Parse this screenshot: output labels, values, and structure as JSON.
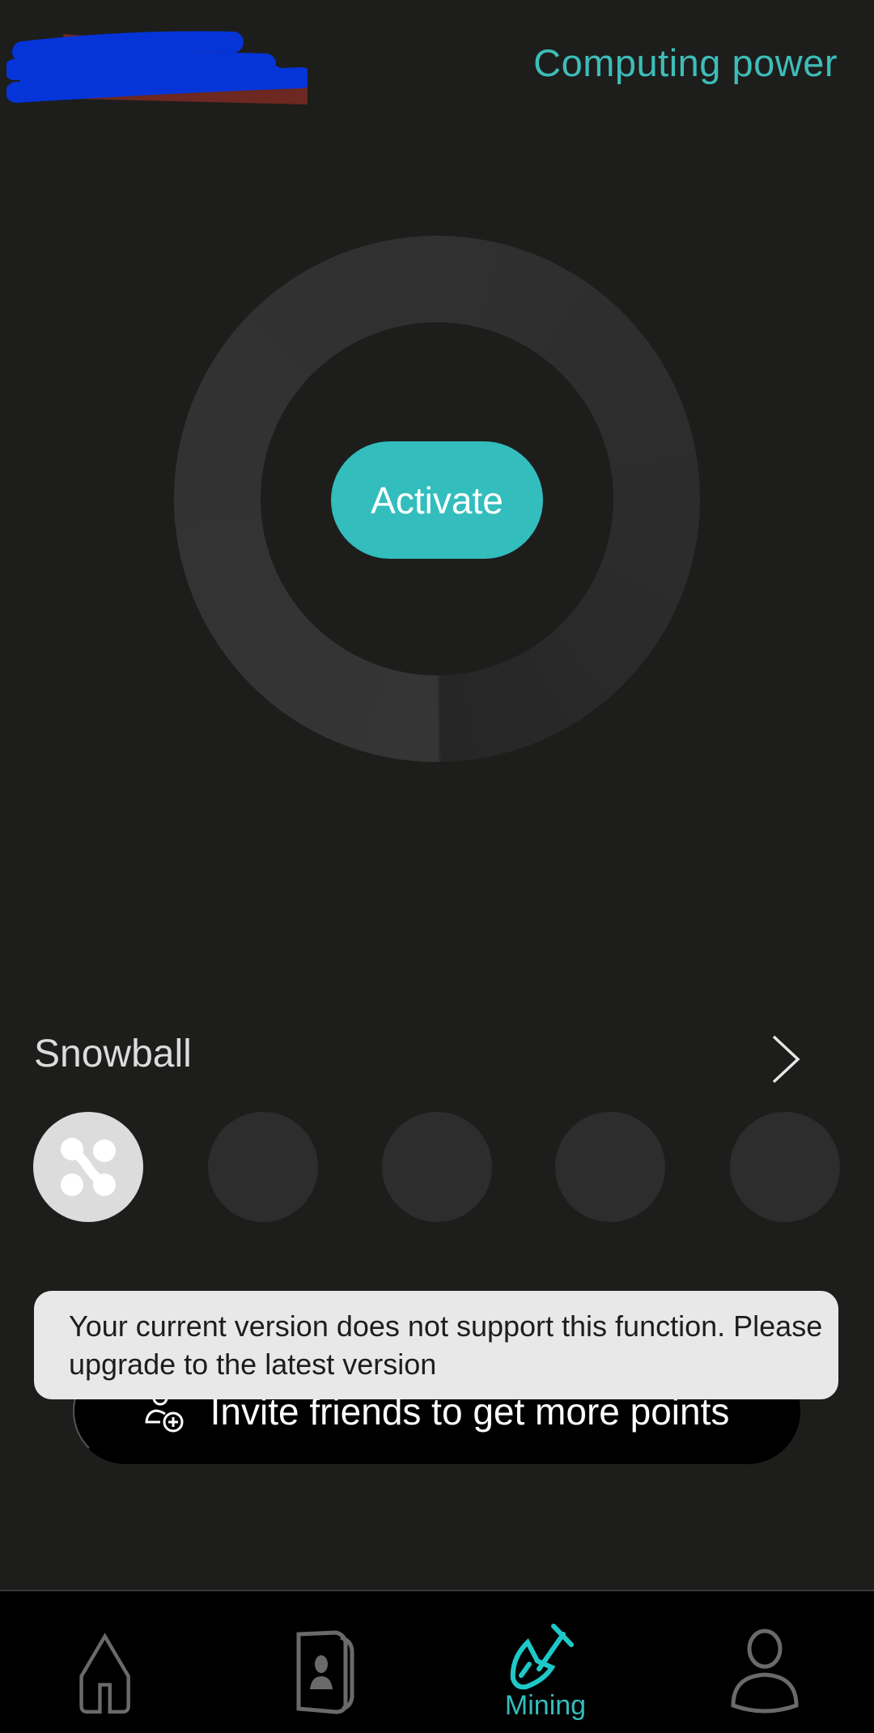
{
  "header": {
    "title": "Computing power"
  },
  "main": {
    "activate_label": "Activate",
    "snowball": {
      "label": "Snowball",
      "slots": [
        {
          "active": true,
          "icon": "snowball-network-icon"
        },
        {
          "active": false
        },
        {
          "active": false
        },
        {
          "active": false
        },
        {
          "active": false
        }
      ]
    },
    "invite_label": "Invite friends to get more points"
  },
  "toast": {
    "message": "Your current version does not support this function. Please upgrade to the latest version"
  },
  "nav": {
    "items": [
      {
        "icon": "home-icon",
        "label": ""
      },
      {
        "icon": "contacts-book-icon",
        "label": ""
      },
      {
        "icon": "shovel-icon",
        "label": "Mining",
        "active": true
      },
      {
        "icon": "profile-icon",
        "label": ""
      }
    ]
  },
  "colors": {
    "accent": "#33bdbd",
    "background": "#1d1d1c",
    "nav_bg": "#000000",
    "toast_bg": "#e8e8e8"
  }
}
